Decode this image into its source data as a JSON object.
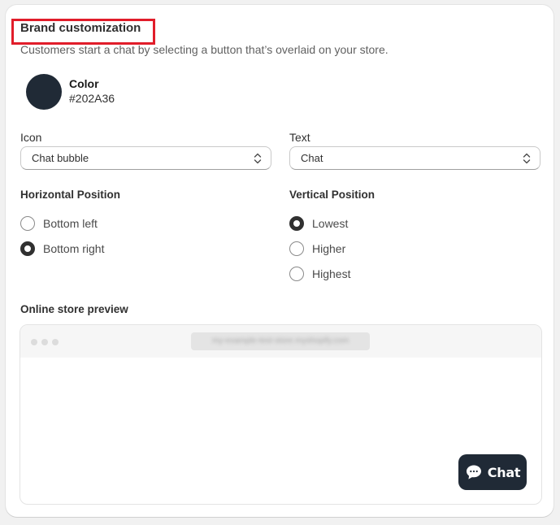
{
  "header": {
    "title": "Brand customization",
    "subtitle": "Customers start a chat by selecting a button that’s overlaid on your store."
  },
  "color": {
    "label": "Color",
    "value": "#202A36",
    "swatch_hex": "#202A36"
  },
  "icon_select": {
    "label": "Icon",
    "value": "Chat bubble"
  },
  "text_select": {
    "label": "Text",
    "value": "Chat"
  },
  "horizontal_position": {
    "label": "Horizontal Position",
    "options": [
      {
        "label": "Bottom left",
        "checked": false
      },
      {
        "label": "Bottom right",
        "checked": true
      }
    ]
  },
  "vertical_position": {
    "label": "Vertical Position",
    "options": [
      {
        "label": "Lowest",
        "checked": true
      },
      {
        "label": "Higher",
        "checked": false
      },
      {
        "label": "Highest",
        "checked": false
      }
    ]
  },
  "preview": {
    "label": "Online store preview",
    "url_blurred": "my-example-test-store.myshopify.com",
    "chat_button": {
      "label": "Chat",
      "icon": "chat-bubble-icon",
      "background": "#202A36"
    }
  },
  "highlight": {
    "color": "#E11D2A"
  }
}
